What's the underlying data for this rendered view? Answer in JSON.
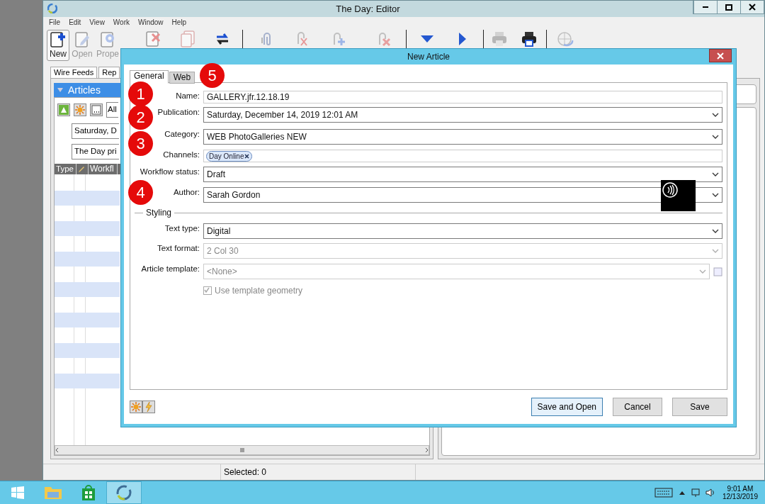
{
  "window": {
    "title": "The Day: Editor"
  },
  "menu": [
    "File",
    "Edit",
    "View",
    "Work",
    "Window",
    "Help"
  ],
  "toolbar": [
    [
      {
        "kind": "new",
        "label": "New",
        "selected": true,
        "disabled": false
      },
      {
        "kind": "open",
        "label": "Open",
        "selected": false,
        "disabled": true
      },
      {
        "kind": "properties",
        "label": "Prope",
        "selected": false,
        "disabled": true
      },
      {
        "kind": "delete",
        "selected": false,
        "disabled": true
      },
      {
        "kind": "copy",
        "selected": false,
        "disabled": true
      },
      {
        "kind": "sync",
        "selected": false,
        "disabled": false
      }
    ],
    [
      {
        "kind": "attach",
        "selected": false,
        "disabled": true
      },
      {
        "kind": "detach",
        "selected": false,
        "disabled": true
      },
      {
        "kind": "attach-add",
        "selected": false,
        "disabled": true
      },
      {
        "kind": "attach-remove",
        "selected": false,
        "disabled": true
      }
    ],
    [
      {
        "kind": "down",
        "selected": false,
        "disabled": false
      },
      {
        "kind": "right",
        "selected": false,
        "disabled": false
      }
    ],
    [
      {
        "kind": "print",
        "selected": false,
        "disabled": true
      },
      {
        "kind": "print-dark",
        "selected": false,
        "disabled": false
      }
    ],
    [
      {
        "kind": "globe",
        "selected": false,
        "disabled": true
      }
    ]
  ],
  "tabs": [
    "Wire Feeds",
    "Rep"
  ],
  "articles": {
    "title": "Articles",
    "filter": "All",
    "date": "Saturday, D",
    "publication": "The Day pri",
    "columns": [
      "Type",
      "Workfl"
    ]
  },
  "status_bar": {
    "selected": "Selected: 0"
  },
  "dialog": {
    "title": "New Article",
    "tabs": [
      {
        "label": "General",
        "selected": true
      },
      {
        "label": "Web",
        "selected": false
      }
    ],
    "fields": [
      {
        "kind": "text",
        "label": "Name:",
        "value": "GALLERY.jfr.12.18.19"
      },
      {
        "kind": "select",
        "label": "Publication:",
        "value": "Saturday, December 14, 2019 12:01 AM",
        "disabled": false
      },
      {
        "kind": "select",
        "label": "Category:",
        "value": "WEB PhotoGalleries NEW",
        "disabled": false
      },
      {
        "kind": "chips",
        "label": "Channels:",
        "chips": [
          "Day Online"
        ]
      },
      {
        "kind": "select",
        "label": "Workflow status:",
        "value": "Draft",
        "disabled": false
      },
      {
        "kind": "select",
        "label": "Author:",
        "value": "Sarah Gordon",
        "disabled": false
      }
    ],
    "styling": {
      "title": "Styling",
      "fields": [
        {
          "kind": "select",
          "label": "Text type:",
          "value": "Digital",
          "disabled": false
        },
        {
          "kind": "select",
          "label": "Text format:",
          "value": "2 Col 30",
          "disabled": true
        },
        {
          "kind": "template",
          "label": "Article template:",
          "value": "<None>",
          "disabled": true
        },
        {
          "kind": "checkbox",
          "label": "Use template geometry",
          "checked": true,
          "disabled": true
        }
      ]
    },
    "buttons": [
      {
        "label": "Save and Open",
        "default": true
      },
      {
        "label": "Cancel",
        "default": false
      },
      {
        "label": "Save",
        "default": false
      }
    ],
    "callouts": [
      "1",
      "2",
      "3",
      "4",
      "5"
    ]
  },
  "taskbar": {
    "time": "9:01 AM",
    "date": "12/13/2019"
  }
}
